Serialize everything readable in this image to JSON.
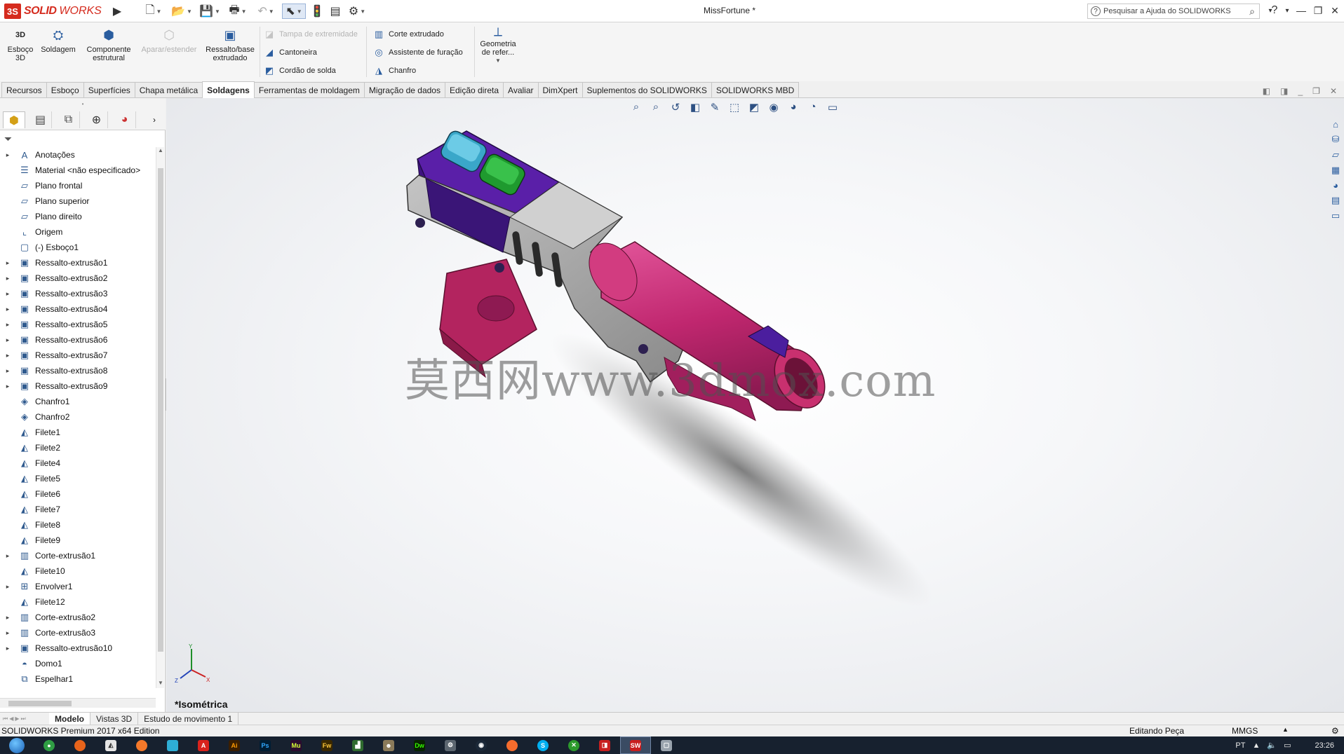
{
  "app": {
    "logo_ds": "3S",
    "logo_solid": "SOLID",
    "logo_works": "WORKS",
    "document_title": "MissFortune *",
    "help_search_placeholder": "Pesquisar a Ajuda do SOLIDWORKS"
  },
  "quick_access": [
    "new-document-icon",
    "open-icon",
    "save-icon",
    "print-icon",
    "undo-icon",
    "select-icon",
    "rebuild-icon",
    "file-properties-icon",
    "options-icon"
  ],
  "ribbon": {
    "esboco3d": "Esboço\n3D",
    "soldagem": "Soldagem",
    "componente": "Componente\nestrutural",
    "aparar": "Aparar/estender",
    "ressalto": "Ressalto/base\nextrudado",
    "tampa": "Tampa de extremidade",
    "cantoneira": "Cantoneira",
    "cordao": "Cordão de solda",
    "corte": "Corte extrudado",
    "assistente": "Assistente de furação",
    "chanfro": "Chanfro",
    "geometria": "Geometria\nde refer..."
  },
  "tabs": [
    "Recursos",
    "Esboço",
    "Superfícies",
    "Chapa metálica",
    "Soldagens",
    "Ferramentas de moldagem",
    "Migração de dados",
    "Edição direta",
    "Avaliar",
    "DimXpert",
    "Suplementos do SOLIDWORKS",
    "SOLIDWORKS MBD"
  ],
  "active_tab": "Soldagens",
  "tree": [
    {
      "label": "Anotações",
      "icon": "annotations-icon",
      "expandable": true
    },
    {
      "label": "Material <não especificado>",
      "icon": "material-icon",
      "expandable": false
    },
    {
      "label": "Plano frontal",
      "icon": "plane-icon",
      "expandable": false
    },
    {
      "label": "Plano superior",
      "icon": "plane-icon",
      "expandable": false
    },
    {
      "label": "Plano direito",
      "icon": "plane-icon",
      "expandable": false
    },
    {
      "label": "Origem",
      "icon": "origin-icon",
      "expandable": false
    },
    {
      "label": "(-) Esboço1",
      "icon": "sketch-icon",
      "expandable": false
    },
    {
      "label": "Ressalto-extrusão1",
      "icon": "extrude-icon",
      "expandable": true
    },
    {
      "label": "Ressalto-extrusão2",
      "icon": "extrude-icon",
      "expandable": true
    },
    {
      "label": "Ressalto-extrusão3",
      "icon": "extrude-icon",
      "expandable": true
    },
    {
      "label": "Ressalto-extrusão4",
      "icon": "extrude-icon",
      "expandable": true
    },
    {
      "label": "Ressalto-extrusão5",
      "icon": "extrude-icon",
      "expandable": true
    },
    {
      "label": "Ressalto-extrusão6",
      "icon": "extrude-icon",
      "expandable": true
    },
    {
      "label": "Ressalto-extrusão7",
      "icon": "extrude-icon",
      "expandable": true
    },
    {
      "label": "Ressalto-extrusão8",
      "icon": "extrude-icon",
      "expandable": true
    },
    {
      "label": "Ressalto-extrusão9",
      "icon": "extrude-icon",
      "expandable": true
    },
    {
      "label": "Chanfro1",
      "icon": "chamfer-icon",
      "expandable": false
    },
    {
      "label": "Chanfro2",
      "icon": "chamfer-icon",
      "expandable": false
    },
    {
      "label": "Filete1",
      "icon": "fillet-icon",
      "expandable": false
    },
    {
      "label": "Filete2",
      "icon": "fillet-icon",
      "expandable": false
    },
    {
      "label": "Filete4",
      "icon": "fillet-icon",
      "expandable": false
    },
    {
      "label": "Filete5",
      "icon": "fillet-icon",
      "expandable": false
    },
    {
      "label": "Filete6",
      "icon": "fillet-icon",
      "expandable": false
    },
    {
      "label": "Filete7",
      "icon": "fillet-icon",
      "expandable": false
    },
    {
      "label": "Filete8",
      "icon": "fillet-icon",
      "expandable": false
    },
    {
      "label": "Filete9",
      "icon": "fillet-icon",
      "expandable": false
    },
    {
      "label": "Corte-extrusão1",
      "icon": "cut-extrude-icon",
      "expandable": true
    },
    {
      "label": "Filete10",
      "icon": "fillet-icon",
      "expandable": false
    },
    {
      "label": "Envolver1",
      "icon": "wrap-icon",
      "expandable": true
    },
    {
      "label": "Filete12",
      "icon": "fillet-icon",
      "expandable": false
    },
    {
      "label": "Corte-extrusão2",
      "icon": "cut-extrude-icon",
      "expandable": true
    },
    {
      "label": "Corte-extrusão3",
      "icon": "cut-extrude-icon",
      "expandable": true
    },
    {
      "label": "Ressalto-extrusão10",
      "icon": "extrude-icon",
      "expandable": true
    },
    {
      "label": "Domo1",
      "icon": "dome-icon",
      "expandable": false
    },
    {
      "label": "Espelhar1",
      "icon": "mirror-icon",
      "expandable": false
    }
  ],
  "viewport": {
    "view_label": "*Isométrica",
    "watermark": "莫西网www.3dmox.com",
    "triad_x": "X",
    "triad_y": "Y",
    "triad_z": "Z",
    "colors": {
      "purple": "#5a1fa8",
      "magenta": "#c0276f",
      "gray": "#9a9a9a",
      "cyan": "#3aa7c9",
      "green": "#1f9a2f"
    }
  },
  "bottom_tabs": [
    "Modelo",
    "Vistas 3D",
    "Estudo de movimento 1"
  ],
  "active_bottom_tab": "Modelo",
  "status": {
    "edition": "SOLIDWORKS Premium 2017 x64 Edition",
    "mode": "Editando Peça",
    "units": "MMGS",
    "lang": "PT",
    "time": "23:26"
  }
}
